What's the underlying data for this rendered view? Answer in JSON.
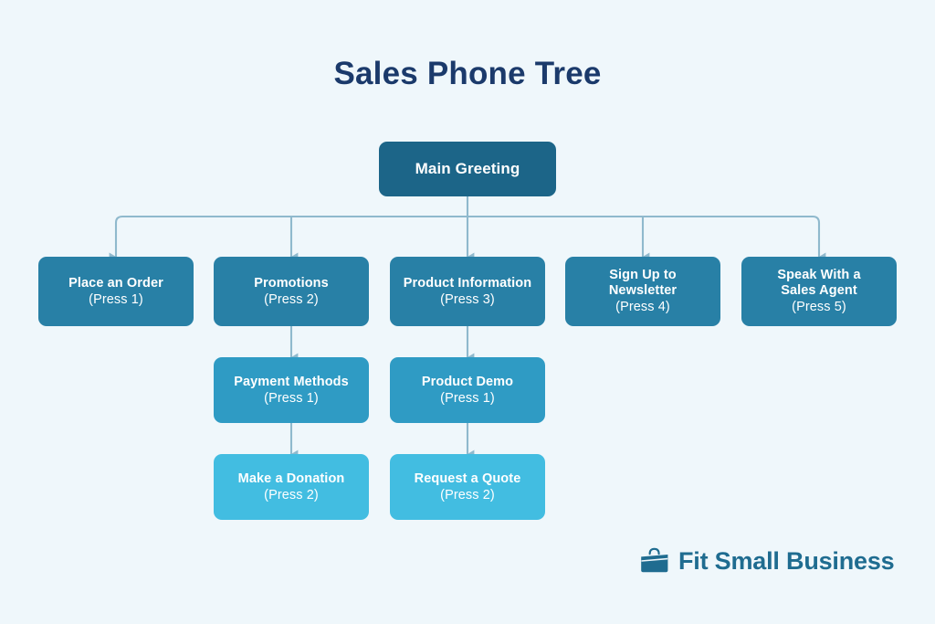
{
  "page": {
    "title": "Sales Phone Tree",
    "background_color": "#eff7fb",
    "title_color": "#1b3a6b"
  },
  "colors": {
    "tier_root": "#1c6588",
    "tier_two": "#2880a6",
    "tier_three": "#2f9bc4",
    "tier_four": "#42bde1",
    "connector": "#8fb9cd",
    "logo": "#1f6c90"
  },
  "chart_data": {
    "type": "diagram",
    "title": "Sales Phone Tree",
    "diagram_kind": "phone-tree",
    "root": {
      "id": "main-greeting",
      "label": "Main Greeting",
      "press": "",
      "tier": 1
    },
    "branches": [
      {
        "id": "place-an-order",
        "label": "Place an Order",
        "press": "(Press 1)",
        "tier": 2,
        "children": []
      },
      {
        "id": "promotions",
        "label": "Promotions",
        "press": "(Press 2)",
        "tier": 2,
        "children": [
          {
            "id": "payment-methods",
            "label": "Payment Methods",
            "press": "(Press 1)",
            "tier": 3,
            "children": [
              {
                "id": "make-a-donation",
                "label": "Make a Donation",
                "press": "(Press 2)",
                "tier": 4,
                "children": []
              }
            ]
          }
        ]
      },
      {
        "id": "product-information",
        "label": "Product Information",
        "press": "(Press 3)",
        "tier": 2,
        "children": [
          {
            "id": "product-demo",
            "label": "Product Demo",
            "press": "(Press 1)",
            "tier": 3,
            "children": [
              {
                "id": "request-a-quote",
                "label": "Request a Quote",
                "press": "(Press 2)",
                "tier": 4,
                "children": []
              }
            ]
          }
        ]
      },
      {
        "id": "sign-up-to-newsletter",
        "label": "Sign Up to\nNewsletter",
        "press": "(Press 4)",
        "tier": 2,
        "children": []
      },
      {
        "id": "speak-with-a-sales-agent",
        "label": "Speak With a\nSales Agent",
        "press": "(Press 5)",
        "tier": 2,
        "children": []
      }
    ]
  },
  "nodes": {
    "main_greeting": {
      "label": "Main Greeting"
    },
    "place_an_order": {
      "label": "Place an Order",
      "press": "(Press 1)"
    },
    "promotions": {
      "label": "Promotions",
      "press": "(Press 2)"
    },
    "product_information": {
      "label": "Product Information",
      "press": "(Press 3)"
    },
    "sign_up_to_newsletter": {
      "label": "Sign Up to\nNewsletter",
      "press": "(Press 4)"
    },
    "speak_with_a_sales_agent": {
      "label": "Speak With a\nSales Agent",
      "press": "(Press 5)"
    },
    "payment_methods": {
      "label": "Payment Methods",
      "press": "(Press 1)"
    },
    "product_demo": {
      "label": "Product Demo",
      "press": "(Press 1)"
    },
    "make_a_donation": {
      "label": "Make a Donation",
      "press": "(Press 2)"
    },
    "request_a_quote": {
      "label": "Request a Quote",
      "press": "(Press 2)"
    }
  },
  "logo": {
    "text": "Fit Small Business",
    "icon": "briefcase-icon"
  }
}
